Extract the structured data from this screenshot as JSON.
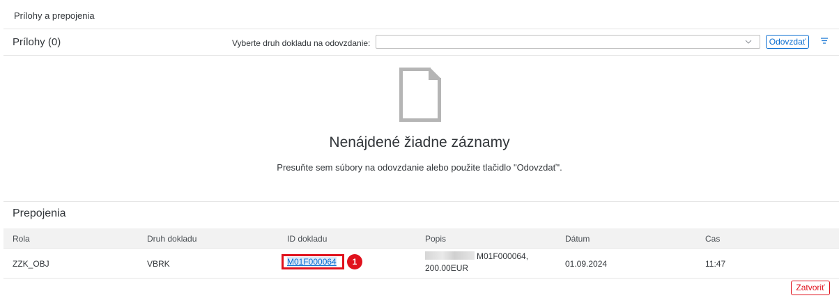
{
  "dialog": {
    "title": "Prílohy a prepojenia"
  },
  "attachments": {
    "title": "Prílohy (0)",
    "doctype_label": "Vyberte druh dokladu na odovzdanie:",
    "doctype_value": "",
    "upload_label": "Odovzdať",
    "settings_icon": "list-settings-icon",
    "empty_icon": "document-icon",
    "empty_title": "Nenájdené žiadne záznamy",
    "empty_subtitle": "Presuňte sem súbory na odovzdanie alebo použite tlačidlo \"Odovzdať\"."
  },
  "links": {
    "title": "Prepojenia",
    "columns": [
      "Rola",
      "Druh dokladu",
      "ID dokladu",
      "Popis",
      "Dátum",
      "Cas"
    ],
    "rows": [
      {
        "role": "ZZK_OBJ",
        "doc_type": "VBRK",
        "doc_id": "M01F000064",
        "marker": "1",
        "desc_line1": "M01F000064,",
        "desc_line2": "200.00EUR",
        "date": "01.09.2024",
        "time": "11:47"
      }
    ]
  },
  "footer": {
    "close_label": "Zatvoriť"
  },
  "colors": {
    "accent": "#0a6ed1",
    "highlight": "#e0121d"
  }
}
